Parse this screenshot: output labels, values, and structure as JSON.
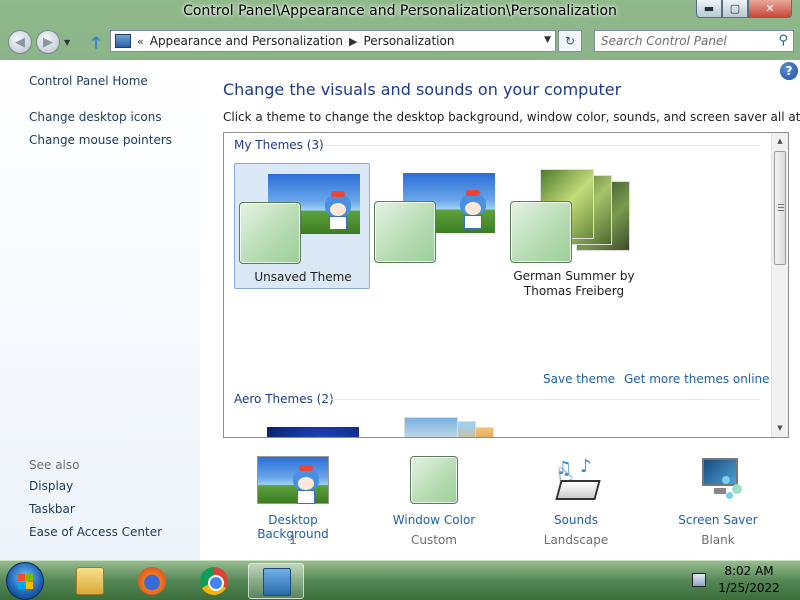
{
  "window": {
    "title": "Control Panel\\Appearance and Personalization\\Personalization"
  },
  "navbar": {
    "breadcrumbs": [
      "Appearance and Personalization",
      "Personalization"
    ],
    "search_placeholder": "Search Control Panel",
    "refresh_glyph": "↻"
  },
  "sidebar": {
    "items": [
      {
        "label": "Control Panel Home"
      },
      {
        "label": "Change desktop icons"
      },
      {
        "label": "Change mouse pointers"
      }
    ],
    "see_also_title": "See also",
    "see_also": [
      {
        "label": "Display"
      },
      {
        "label": "Taskbar"
      },
      {
        "label": "Ease of Access Center"
      }
    ]
  },
  "main": {
    "help_glyph": "?",
    "title": "Change the visuals and sounds on your computer",
    "description": "Click a theme to change the desktop background, window color, sounds, and screen saver all at once."
  },
  "themes": {
    "my_themes_header": "My Themes (3)",
    "aero_themes_header": "Aero Themes (2)",
    "my_themes": [
      {
        "label": "Unsaved Theme",
        "selected": true
      },
      {
        "label": "",
        "selected": false
      },
      {
        "label": "German Summer by Thomas Freiberg",
        "selected": false
      }
    ],
    "save_theme_link": "Save theme",
    "more_themes_link": "Get more themes online"
  },
  "bottom": {
    "items": [
      {
        "label": "Desktop Background",
        "sub": "1",
        "icon": "desktop-background-icon"
      },
      {
        "label": "Window Color",
        "sub": "Custom",
        "icon": "window-color-icon"
      },
      {
        "label": "Sounds",
        "sub": "Landscape",
        "icon": "sounds-icon"
      },
      {
        "label": "Screen Saver",
        "sub": "Blank",
        "icon": "screen-saver-icon"
      }
    ]
  },
  "taskbar": {
    "apps": [
      "start-orb",
      "file-explorer",
      "firefox",
      "chrome",
      "control-panel"
    ],
    "time": "8:02 AM",
    "date": "1/25/2022"
  },
  "colors": {
    "link": "#1e5fa8",
    "heading": "#1e3a8a",
    "selected_theme_bg": "#dbe9f7"
  }
}
